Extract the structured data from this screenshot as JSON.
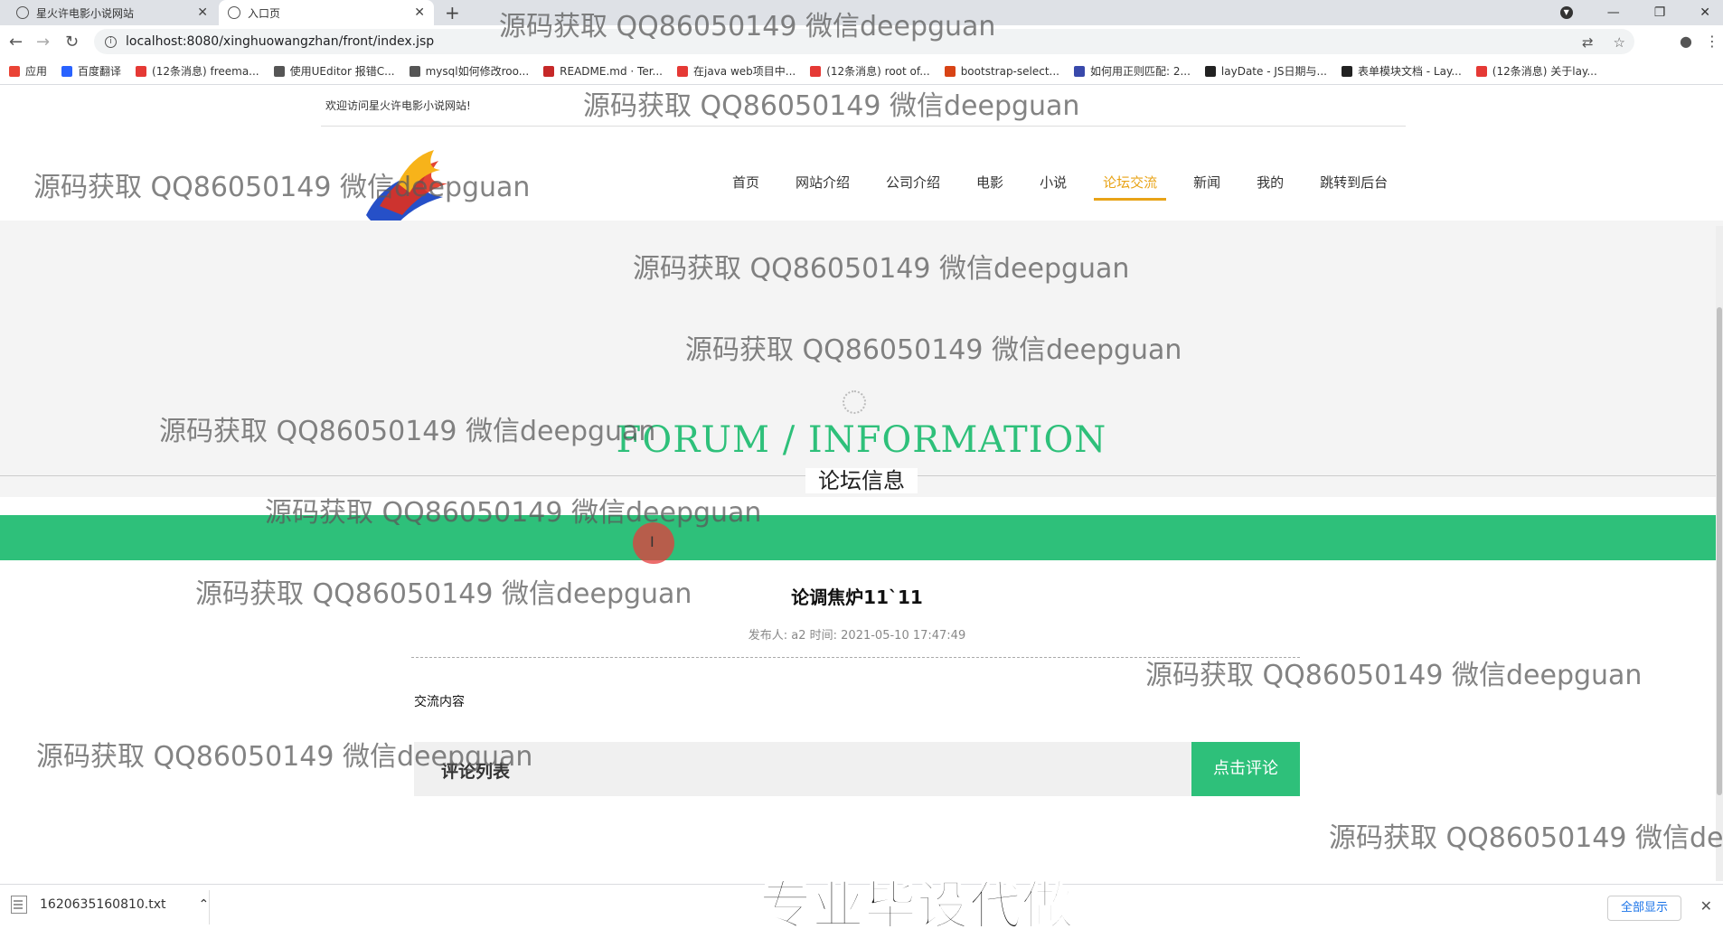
{
  "browser": {
    "tabs": [
      {
        "title": "星火许电影小说网站"
      },
      {
        "title": "入口页"
      }
    ],
    "url": "localhost:8080/xinghuowangzhan/front/index.jsp",
    "bookmarks": [
      {
        "label": "应用",
        "color": "#ea4335"
      },
      {
        "label": "百度翻译",
        "color": "#2962ff"
      },
      {
        "label": "(12条消息) freema...",
        "color": "#e53935"
      },
      {
        "label": "使用UEditor 报错C...",
        "color": "#555555"
      },
      {
        "label": "mysql如何修改roo...",
        "color": "#555555"
      },
      {
        "label": "README.md · Ter...",
        "color": "#c62828"
      },
      {
        "label": "在java web项目中...",
        "color": "#e53935"
      },
      {
        "label": "(12条消息) root of...",
        "color": "#e53935"
      },
      {
        "label": "bootstrap-select...",
        "color": "#d84315"
      },
      {
        "label": "如何用正则匹配: 2...",
        "color": "#3949ab"
      },
      {
        "label": "layDate - JS日期与...",
        "color": "#222222"
      },
      {
        "label": "表单模块文档 - Lay...",
        "color": "#222222"
      },
      {
        "label": "(12条消息) 关于lay...",
        "color": "#e53935"
      }
    ]
  },
  "site": {
    "welcome": "欢迎访问星火许电影小说网站!",
    "nav": [
      "首页",
      "网站介绍",
      "公司介绍",
      "电影",
      "小说",
      "论坛交流",
      "新闻",
      "我的",
      "跳转到后台"
    ],
    "active_nav": "论坛交流"
  },
  "section": {
    "title_en": "FORUM / INFORMATION",
    "title_cn": "论坛信息"
  },
  "post": {
    "title": "论调焦炉11`11",
    "meta": "发布人: a2 时间: 2021-05-10 17:47:49",
    "content": "交流内容"
  },
  "comments": {
    "title": "评论列表",
    "button": "点击评论"
  },
  "downloads": {
    "file": "1620635160810.txt",
    "show_all": "全部显示"
  },
  "watermark": {
    "text": "源码获取 QQ86050149 微信deepguan",
    "banner": "专业毕设代做"
  },
  "colors": {
    "accent_green": "#2ec07a",
    "nav_active": "#e8a317"
  }
}
